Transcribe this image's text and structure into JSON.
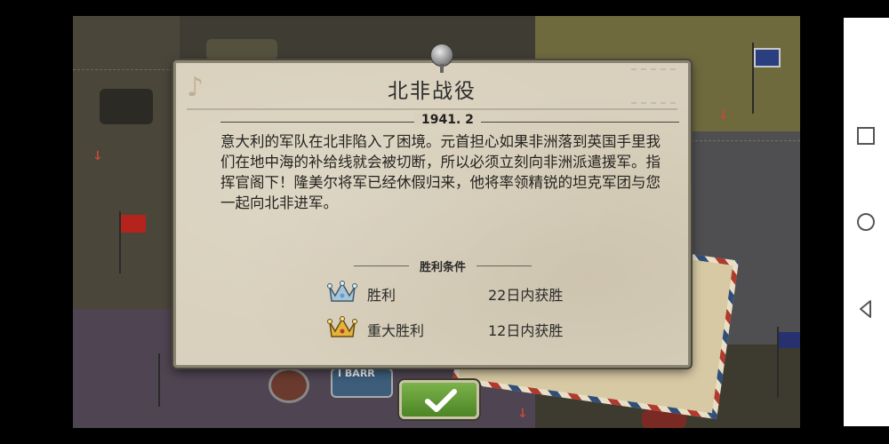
{
  "dialog": {
    "title": "北非战役",
    "date": "1941. 2",
    "body": "意大利的军队在北非陷入了困境。元首担心如果非洲落到英国手里我们在地中海的补给线就会被切断，所以必须立刻向非洲派遣援军。指挥官阁下！隆美尔将军已经休假归来，他将率领精锐的坦克军团与您一起向北非进军。",
    "conditions_title": "胜利条件",
    "conditions": [
      {
        "label": "胜利",
        "value": "22日内获胜",
        "icon": "silver-crown-icon"
      },
      {
        "label": "重大胜利",
        "value": "12日内获胜",
        "icon": "gold-crown-icon"
      }
    ]
  },
  "confirm": {
    "icon": "checkmark-icon"
  },
  "map": {
    "partial_label": "I BARR"
  },
  "navbar": {
    "icons": [
      "square-recent-icon",
      "circle-home-icon",
      "triangle-back-icon"
    ]
  },
  "colors": {
    "dialog_bg": "#d9d1bd",
    "confirm_green": "#5f9a34",
    "crown_gold": "#e2b53a",
    "crown_silver": "#a9c4d6"
  }
}
